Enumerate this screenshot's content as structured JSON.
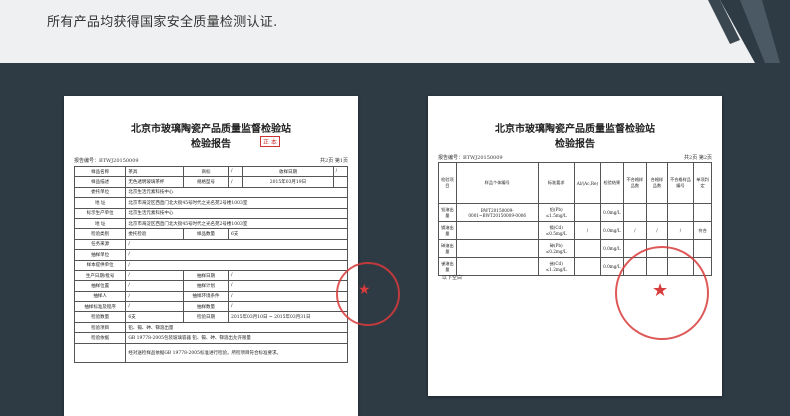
{
  "header": {
    "text": "所有产品均获得国家安全质量检测认证."
  },
  "report1": {
    "title_line1": "北京市玻璃陶瓷产品质量监督检验站",
    "title_line2": "检验报告",
    "stamp_text": "正 本",
    "report_no": "报告编号：BTWJ20150009",
    "page_no": "共2页 第1页",
    "rows": [
      [
        "样品名称",
        "茶具",
        "商标",
        "/",
        "收样日期",
        "/"
      ],
      [
        "样品描述",
        "无色透明玻璃茶杯",
        "规格型号",
        "/",
        "2015年03月19日",
        ""
      ],
      [
        "委托单位",
        "北京生活元素科技中心"
      ],
      [
        "地 址",
        "北京市海淀区西直门北大街45号时代之光名苑2号楼1003室"
      ],
      [
        "标示生产单位",
        "北京生活元素科技中心"
      ],
      [
        "地 址",
        "北京市海淀区西直门北大街45号时代之光名苑2号楼1003室"
      ],
      [
        "检验类别",
        "委托检验",
        "样品数量",
        "6支"
      ],
      [
        "任务来源",
        "/"
      ],
      [
        "抽样单位",
        "/"
      ],
      [
        "样本提供单位",
        "/"
      ],
      [
        "生产日期/批号",
        "/",
        "抽样日期",
        "/"
      ],
      [
        "抽样位置",
        "/",
        "抽样计划",
        "/"
      ],
      [
        "抽样人",
        "/",
        "抽样环境条件",
        "/"
      ],
      [
        "抽样标准及程序",
        "/",
        "抽样数量",
        "/"
      ],
      [
        "检验数量",
        "6支",
        "检验日期",
        "2015年03月10日 ~ 2015年03月31日"
      ],
      [
        "检验项目",
        "铅、镉、砷、锑溶出量"
      ],
      [
        "检验依据",
        "GB 19778-2005包装玻璃容器 铅、镉、砷、锑溶出允许限量"
      ],
      [
        "",
        "经对送检样品依据GB 19778-2005标准进行检验，所检项目符合标准要求。"
      ]
    ]
  },
  "report2": {
    "title_line1": "北京市玻璃陶瓷产品质量监督检验站",
    "title_line2": "检验报告",
    "report_no": "报告编号：BTWJ20150009",
    "page_no": "共2页 第2页",
    "headers": [
      "检验项目",
      "样品个体编号",
      "标准要求",
      "Al/(Ac,Re)",
      "检验结果",
      "不合格样品数",
      "合格样品数",
      "不合格样品编号",
      "单项判定"
    ],
    "rows": [
      [
        "铅溶出量",
        "BWT20150009-0001~BWT20150009-0006",
        "铅(Pb) ≤1.5mg/L",
        "",
        "0.0mg/L",
        "",
        "",
        "",
        ""
      ],
      [
        "镉溶出量",
        "",
        "镉(Cd) ≤0.5mg/L",
        "/",
        "0.0mg/L",
        "/",
        "/",
        "/",
        "符合"
      ],
      [
        "砷溶出量",
        "",
        "砷(Pb) ≤0.2mg/L",
        "",
        "0.0mg/L",
        "",
        "",
        "",
        ""
      ],
      [
        "锑溶出量",
        "",
        "锑(Cd) ≤1.2mg/L",
        "",
        "0.0mg/L",
        "",
        "",
        "",
        ""
      ]
    ],
    "footer": "以下空白"
  }
}
